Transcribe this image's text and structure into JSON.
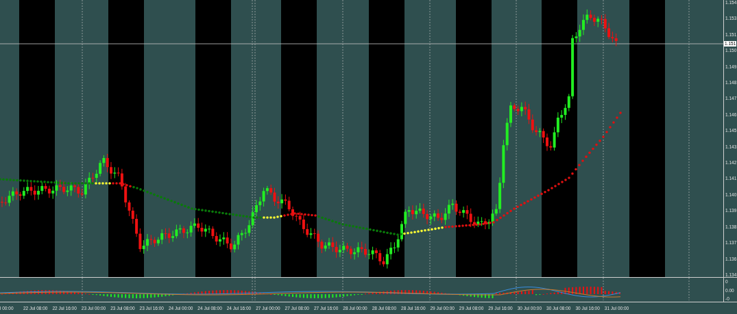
{
  "price_axis": {
    "labels": [
      "1.154",
      "1.153",
      "1.151",
      "1.150",
      "1.149",
      "1.148",
      "1.147",
      "1.146",
      "1.145",
      "1.143",
      "1.142",
      "1.141",
      "1.140",
      "1.139",
      "1.138",
      "1.137",
      "1.136",
      "1.134"
    ],
    "current_price": "1.151"
  },
  "indicator_axis": {
    "labels": [
      "0",
      "0.00",
      "-0"
    ]
  },
  "time_axis": {
    "labels": [
      "l 00:00",
      "22 Jul 08:00",
      "22 Jul 16:00",
      "23 Jul 00:00",
      "23 Jul 08:00",
      "23 Jul 16:00",
      "24 Jul 00:00",
      "24 Jul 08:00",
      "24 Jul 16:00",
      "27 Jul 00:00",
      "27 Jul 08:00",
      "27 Jul 16:00",
      "28 Jul 00:00",
      "28 Jul 08:00",
      "28 Jul 16:00",
      "29 Jul 00:00",
      "29 Jul 08:00",
      "29 Jul 16:00",
      "30 Jul 00:00",
      "30 Jul 08:00",
      "30 Jul 16:00",
      "31 Jul 00:00"
    ]
  }
}
